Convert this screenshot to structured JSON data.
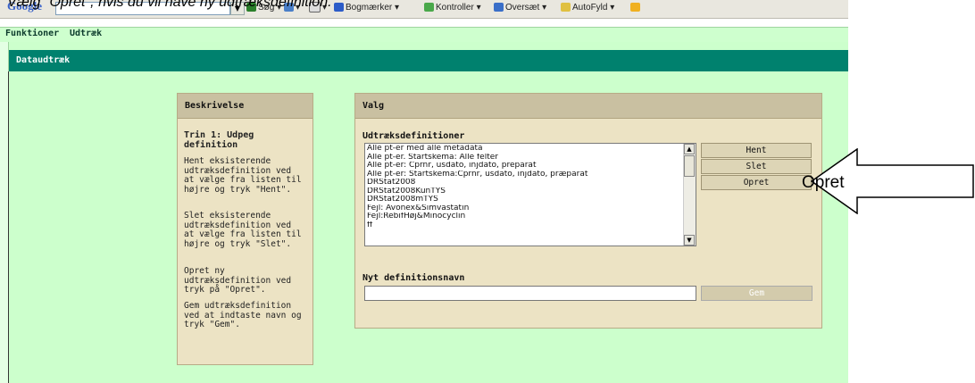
{
  "caption": "Vælg \"Opret\", hvis du vil have ny udtræksdefinition.",
  "browser_toolbar": {
    "search_engine": "Google",
    "search_label": "Søg",
    "bookmarks_label": "Bogmærker",
    "check_label": "Kontroller",
    "translate_label": "Oversæt",
    "autofill_label": "AutoFyld"
  },
  "menu": {
    "items": [
      "Funktioner",
      "Udtræk"
    ]
  },
  "window": {
    "title": "Dataudtræk"
  },
  "description": {
    "heading": "Beskrivelse",
    "step_title": "Trin 1: Udpeg definition",
    "paragraphs": [
      "Hent eksisterende udtræksdefinition ved at vælge fra listen til højre og tryk \"Hent\".",
      "Slet eksisterende udtræksdefinition ved at vælge fra listen til højre og tryk \"Slet\".",
      "Opret ny udtræksdefinition ved tryk på \"Opret\".",
      "Gem udtræksdefinition ved at indtaste navn og tryk \"Gem\"."
    ]
  },
  "valg": {
    "heading": "Valg",
    "list_label": "Udtræksdefinitioner",
    "definitions": [
      "Alle pt-er med alle metadata",
      "Alle pt-er. Startskema: Alle felter",
      "Alle pt-er: Cprnr, usdato, injdato, preparat",
      "Alle pt-er: Startskema:Cprnr, usdato, injdato, præparat",
      "DRStat2008",
      "DRStat2008KunTYS",
      "DRStat2008mTYS",
      "Fejl: Avonex&Simvastatin",
      "Fejl:RebifHøj&Minocyclin",
      "ff"
    ],
    "buttons": {
      "hent": "Hent",
      "slet": "Slet",
      "opret": "Opret",
      "gem": "Gem"
    },
    "new_name_label": "Nyt definitionsnavn",
    "new_name_value": ""
  },
  "callout": {
    "text": "Opret"
  }
}
